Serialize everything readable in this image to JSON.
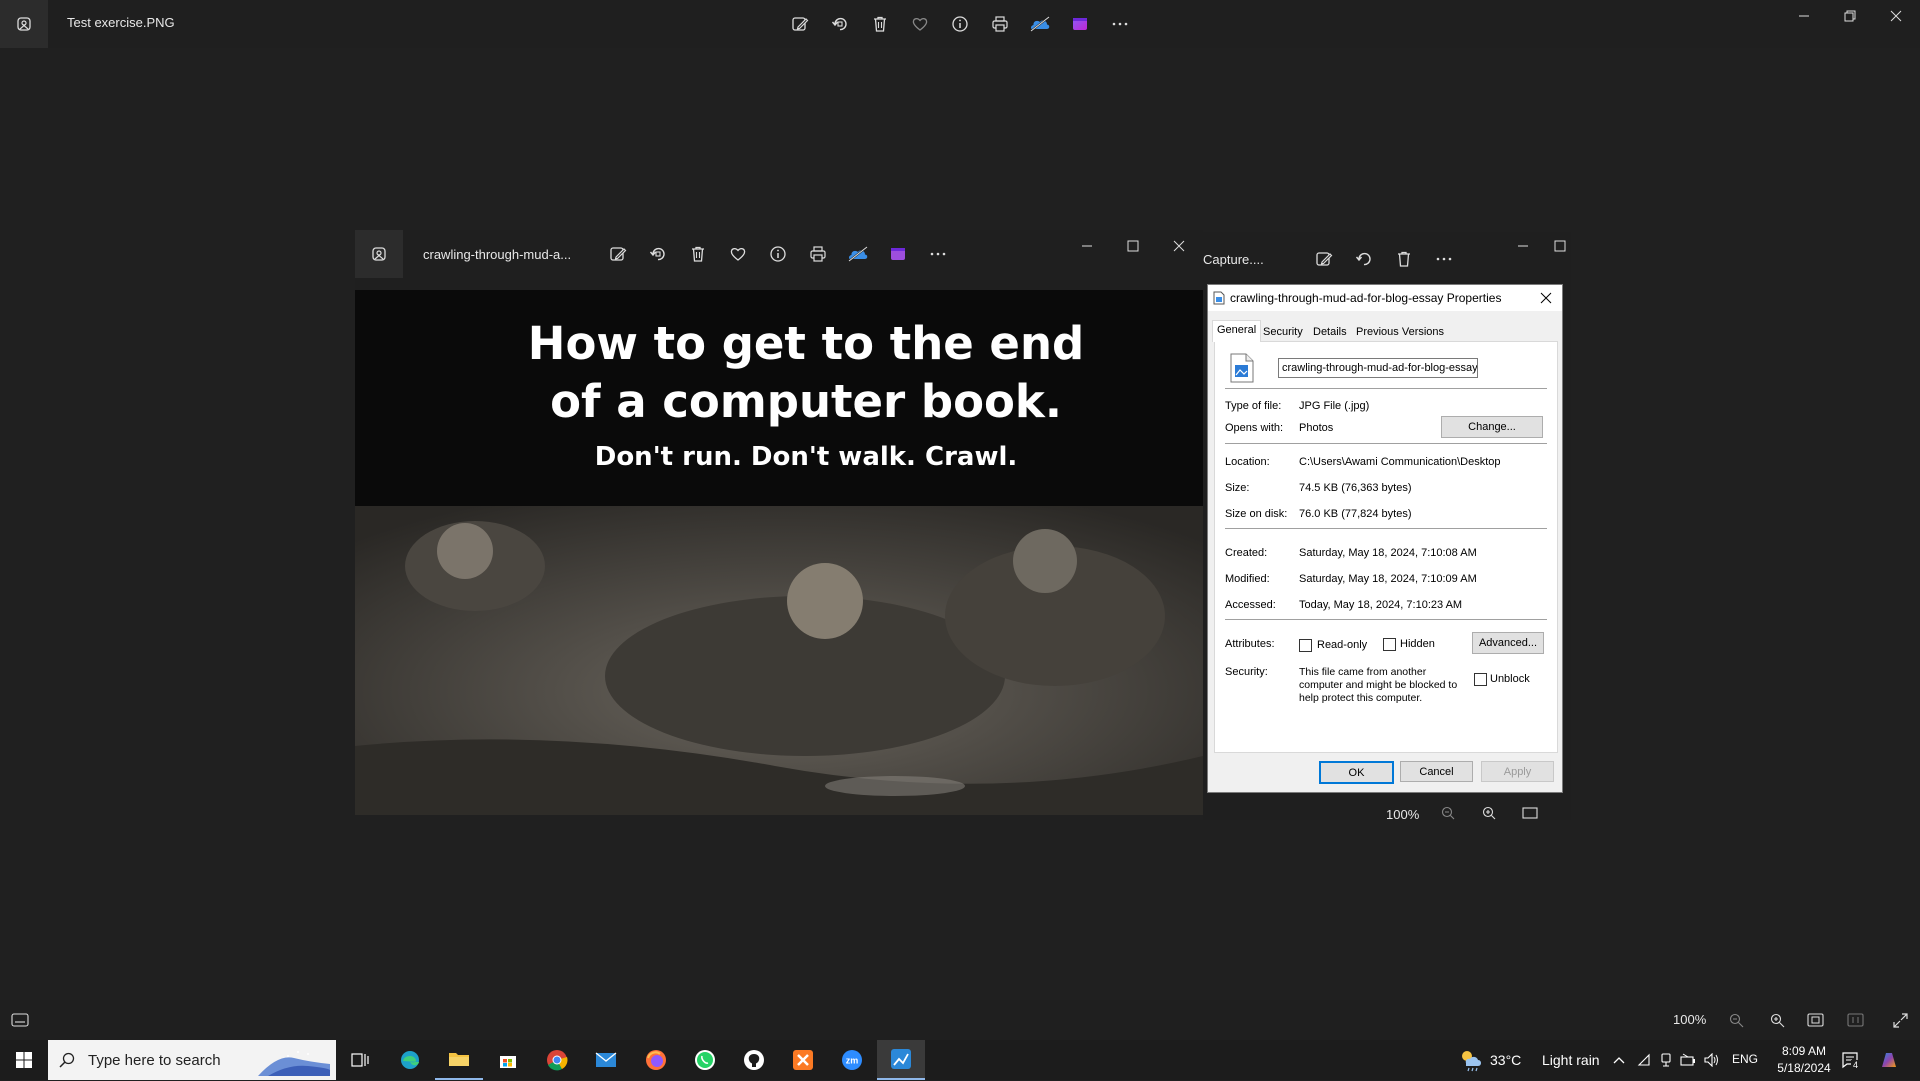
{
  "outer_window": {
    "title": "Test exercise.PNG",
    "toolbar": [
      "edit-icon",
      "rotate-icon",
      "delete-icon",
      "favorite-icon",
      "info-icon",
      "print-icon",
      "onedrive-icon",
      "clipchamp-icon",
      "more-icon"
    ]
  },
  "inner_window": {
    "title": "crawling-through-mud-a...",
    "image": {
      "headline_line1": "How to get to the end",
      "headline_line2": "of a computer book.",
      "tagline": "Don't run. Don't walk. Crawl."
    }
  },
  "back_window": {
    "title": "Capture....",
    "zoom": "100%"
  },
  "properties_dialog": {
    "title": "crawling-through-mud-ad-for-blog-essay Properties",
    "tabs": [
      "General",
      "Security",
      "Details",
      "Previous Versions"
    ],
    "active_tab": "General",
    "filename": "crawling-through-mud-ad-for-blog-essay",
    "type_label": "Type of file:",
    "type_value": "JPG File (.jpg)",
    "opens_label": "Opens with:",
    "opens_value": "Photos",
    "change_button": "Change...",
    "location_label": "Location:",
    "location_value": "C:\\Users\\Awami Communication\\Desktop",
    "size_label": "Size:",
    "size_value": "74.5 KB (76,363 bytes)",
    "size_disk_label": "Size on disk:",
    "size_disk_value": "76.0 KB (77,824 bytes)",
    "created_label": "Created:",
    "created_value": "Saturday, May 18, 2024, 7:10:08 AM",
    "modified_label": "Modified:",
    "modified_value": "Saturday, May 18, 2024, 7:10:09 AM",
    "accessed_label": "Accessed:",
    "accessed_value": "Today, May 18, 2024, 7:10:23 AM",
    "attributes_label": "Attributes:",
    "readonly_label": "Read-only",
    "hidden_label": "Hidden",
    "advanced_button": "Advanced...",
    "security_label": "Security:",
    "security_text_1": "This file came from another",
    "security_text_2": "computer and might be blocked to",
    "security_text_3": "help protect this computer.",
    "unblock_label": "Unblock",
    "ok_button": "OK",
    "cancel_button": "Cancel",
    "apply_button": "Apply"
  },
  "status_bar": {
    "zoom": "100%"
  },
  "taskbar": {
    "search_placeholder": "Type here to search",
    "weather_temp": "33°C",
    "weather_desc": "Light rain",
    "language": "ENG",
    "time": "8:09 AM",
    "date": "5/18/2024",
    "notification_count": "4"
  },
  "colors": {
    "background": "#202020",
    "dialog_bg": "#f0f0f0",
    "ok_border": "#0078d7",
    "taskbar": "#1c1c1c"
  }
}
